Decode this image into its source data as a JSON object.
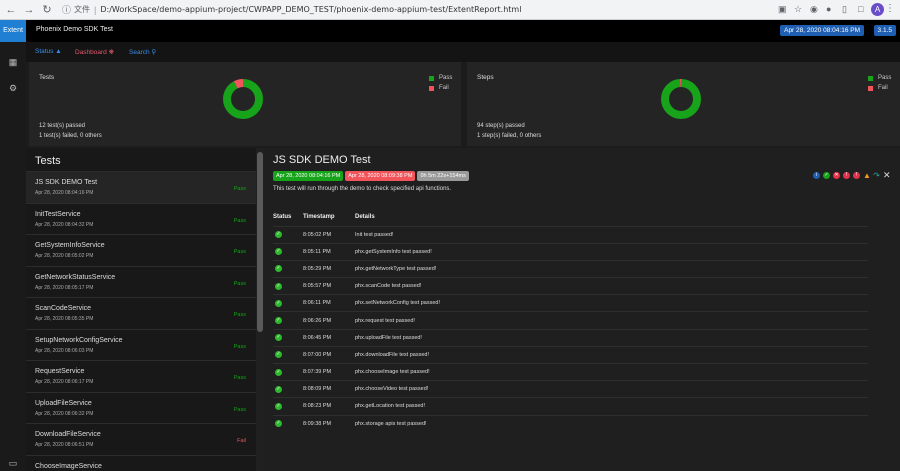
{
  "browser": {
    "protocol_label": "文件",
    "url": "D:/WorkSpace/demo-appium-project/CWPAPP_DEMO_TEST/phoenix-demo-appium-test/ExtentReport.html",
    "account_initial": "A"
  },
  "sidebar": {
    "logo": "Extent"
  },
  "header": {
    "title": "Phoenix Demo SDK Test",
    "date": "Apr 28, 2020 08:04:16 PM",
    "version": "3.1.5"
  },
  "nav": {
    "status": "Status",
    "dashboard": "Dashboard",
    "search": "Search"
  },
  "tests_panel": {
    "label": "Tests",
    "legend_pass": "Pass",
    "legend_fail": "Fail",
    "summary_passed": "12 test(s) passed",
    "summary_failed": "1 test(s) failed, 0 others",
    "passed": 12,
    "failed": 1
  },
  "steps_panel": {
    "label": "Steps",
    "legend_pass": "Pass",
    "legend_fail": "Fail",
    "summary_passed": "94 step(s) passed",
    "summary_failed": "1 step(s) failed, 0 others",
    "passed": 94,
    "failed": 1
  },
  "colors": {
    "pass": "#17a31a",
    "fail": "#f2545b",
    "accent": "#1e5fb4"
  },
  "list": {
    "heading": "Tests",
    "items": [
      {
        "name": "JS SDK DEMO Test",
        "date": "Apr 28, 2020 08:04:16 PM",
        "status": "Pass"
      },
      {
        "name": "InitTestService",
        "date": "Apr 28, 2020 08:04:32 PM",
        "status": "Pass"
      },
      {
        "name": "GetSystemInfoService",
        "date": "Apr 28, 2020 08:05:02 PM",
        "status": "Pass"
      },
      {
        "name": "GetNetworkStatusService",
        "date": "Apr 28, 2020 08:05:17 PM",
        "status": "Pass"
      },
      {
        "name": "ScanCodeService",
        "date": "Apr 28, 2020 08:05:35 PM",
        "status": "Pass"
      },
      {
        "name": "SetupNetworkConfigService",
        "date": "Apr 28, 2020 08:06:03 PM",
        "status": "Pass"
      },
      {
        "name": "RequestService",
        "date": "Apr 28, 2020 08:06:17 PM",
        "status": "Pass"
      },
      {
        "name": "UploadFileService",
        "date": "Apr 28, 2020 08:06:32 PM",
        "status": "Pass"
      },
      {
        "name": "DownloadFileService",
        "date": "Apr 28, 2020 08:06:51 PM",
        "status": "Fail"
      },
      {
        "name": "ChooseImageService",
        "date": "",
        "status": ""
      }
    ]
  },
  "detail": {
    "title": "JS SDK DEMO Test",
    "start": "Apr 28, 2020 08:04:16 PM",
    "end": "Apr 28, 2020 08:09:38 PM",
    "duration": "0h 5m 22s+154ms",
    "description": "This test will run through the demo to check specified api functions.",
    "columns": [
      "Status",
      "Timestamp",
      "Details"
    ],
    "rows": [
      {
        "time": "8:05:02 PM",
        "details": "Init test passed!"
      },
      {
        "time": "8:05:11 PM",
        "details": "phx.getSystemInfo test passed!"
      },
      {
        "time": "8:05:29 PM",
        "details": "phx.getNetworkType test passed!"
      },
      {
        "time": "8:05:57 PM",
        "details": "phx.scanCode test passed!"
      },
      {
        "time": "8:06:11 PM",
        "details": "phx.setNetworkConfig test passed!"
      },
      {
        "time": "8:06:26 PM",
        "details": "phx.request test passed!"
      },
      {
        "time": "8:06:45 PM",
        "details": "phx.uploadFile test passed!"
      },
      {
        "time": "8:07:00 PM",
        "details": "phx.downloadFile test passed!"
      },
      {
        "time": "8:07:39 PM",
        "details": "phx.chooseImage test passed!"
      },
      {
        "time": "8:08:09 PM",
        "details": "phx.chooseVideo test passed!"
      },
      {
        "time": "8:08:23 PM",
        "details": "phx.getLocation test passed!"
      },
      {
        "time": "8:09:38 PM",
        "details": "phx.storage apis test passed!"
      }
    ]
  }
}
